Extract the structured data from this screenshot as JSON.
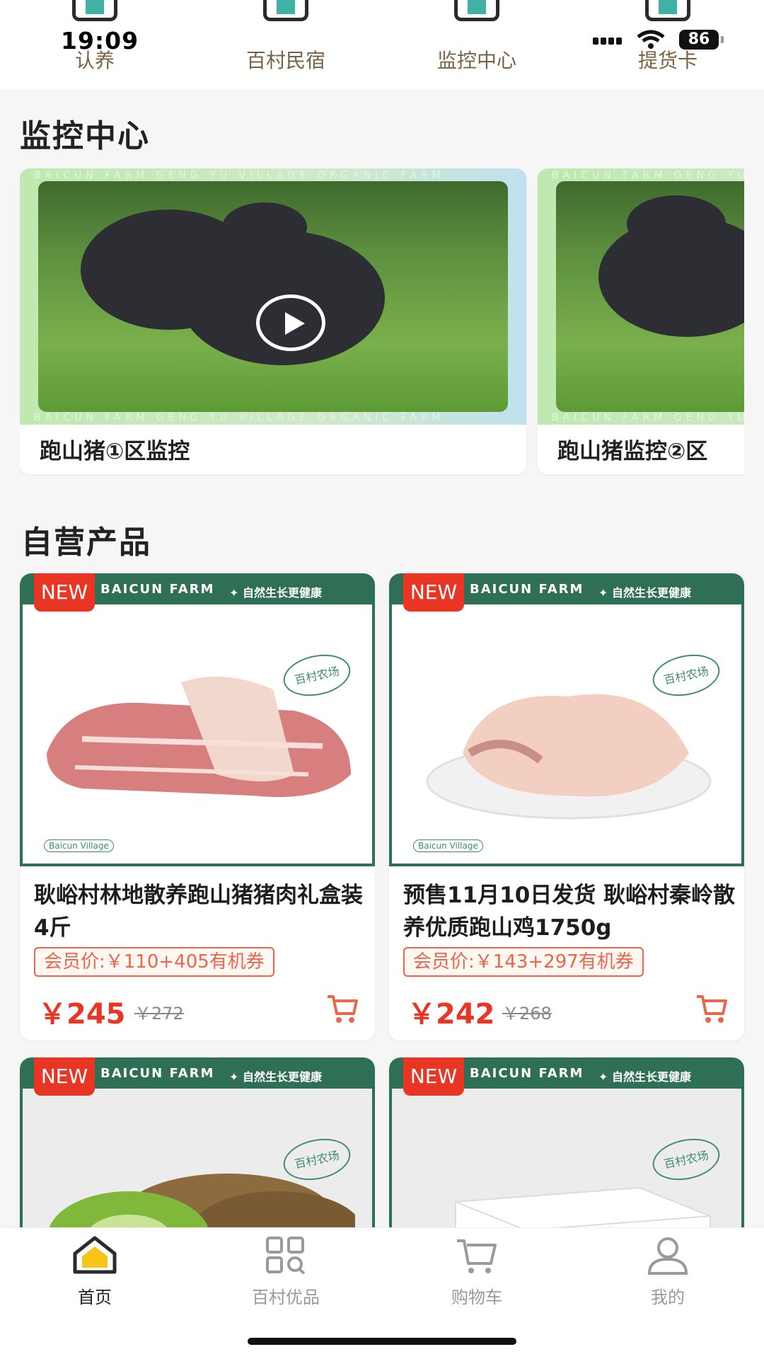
{
  "status": {
    "time": "19:09",
    "battery": "86"
  },
  "quick_nav": [
    {
      "label": "认养"
    },
    {
      "label": "百村民宿"
    },
    {
      "label": "监控中心"
    },
    {
      "label": "提货卡"
    }
  ],
  "monitor": {
    "heading": "监控中心",
    "frame_text": "BAICUN FARM GENG YU VILLAGE ORGANIC FARM",
    "cards": [
      {
        "title": "跑山猪①区监控"
      },
      {
        "title": "跑山猪监控②区"
      }
    ]
  },
  "products": {
    "heading": "自营产品",
    "badge": "NEW",
    "brand": "BAICUN FARM",
    "slogan": "✦ 自然生长更健康",
    "stamp": "百村农场",
    "village": "Baicun Village",
    "items": [
      {
        "name": "耿峪村林地散养跑山猪猪肉礼盒装4斤",
        "member_price": "会员价:￥110+405有机券",
        "price": "￥245",
        "original_price": "￥272"
      },
      {
        "name": "预售11月10日发货 耿峪村秦岭散养优质跑山鸡1750g",
        "member_price": "会员价:￥143+297有机券",
        "price": "￥242",
        "original_price": "￥268"
      },
      {
        "name": "",
        "member_price": "",
        "price": "",
        "original_price": ""
      },
      {
        "name": "",
        "member_price": "",
        "price": "",
        "original_price": ""
      }
    ]
  },
  "tabbar": [
    {
      "label": "首页"
    },
    {
      "label": "百村优品"
    },
    {
      "label": "购物车"
    },
    {
      "label": "我的"
    }
  ],
  "colors": {
    "accent": "#e93523",
    "brand_green": "#2f6f55",
    "nav_text": "#7a6242"
  }
}
